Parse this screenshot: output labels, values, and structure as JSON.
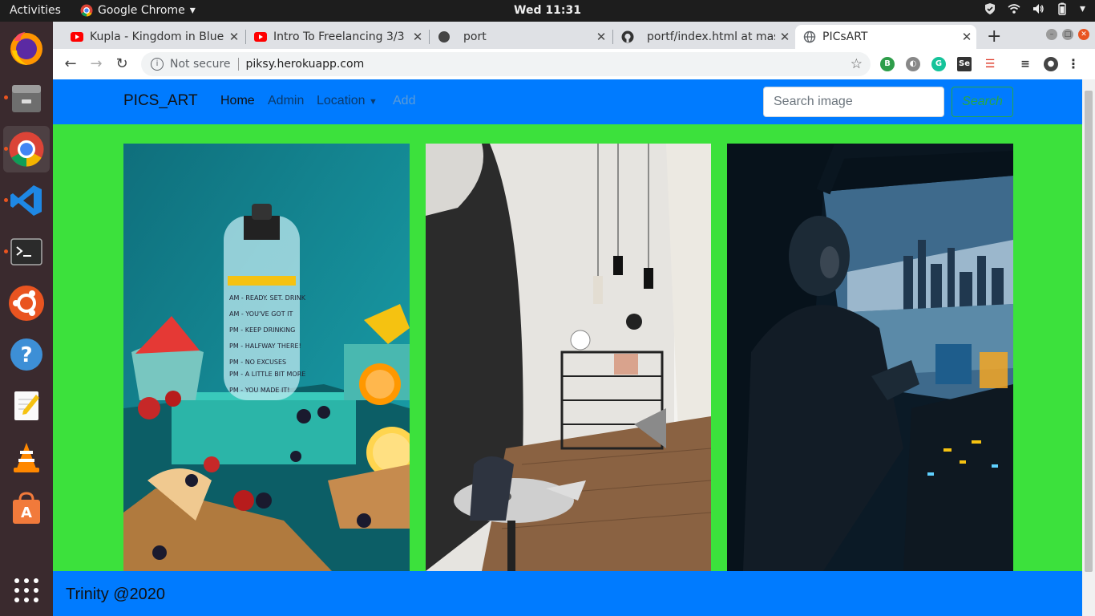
{
  "topbar": {
    "activities": "Activities",
    "app_name": "Google Chrome",
    "clock": "Wed 11:31"
  },
  "dock": {
    "icons": [
      "firefox-icon",
      "files-icon",
      "chrome-icon",
      "vscode-icon",
      "terminal-icon",
      "ubuntu-software-icon",
      "help-icon",
      "text-editor-icon",
      "vlc-icon",
      "software-store-icon",
      "app-grid-icon"
    ]
  },
  "browser": {
    "tabs": [
      {
        "title": "Kupla - Kingdom in Blue",
        "icon": "youtube-icon"
      },
      {
        "title": "Intro To Freelancing 3/3",
        "icon": "youtube-icon"
      },
      {
        "title": "port",
        "icon": "globe-icon"
      },
      {
        "title": "portf/index.html at mas",
        "icon": "github-icon"
      },
      {
        "title": "PICsART",
        "icon": "globe-icon"
      }
    ],
    "security_label": "Not secure",
    "url": "piksy.herokuapp.com"
  },
  "site": {
    "brand": "PICS_ART",
    "nav": {
      "home": "Home",
      "admin": "Admin",
      "location": "Location",
      "add": "Add"
    },
    "search": {
      "placeholder": "Search image",
      "button": "Search"
    },
    "images": [
      {
        "alt": "water bottle with fruits"
      },
      {
        "alt": "interior room"
      },
      {
        "alt": "helicopter pilot"
      }
    ],
    "footer": "Trinity @2020"
  },
  "colors": {
    "navbar": "#007bff",
    "page_bg": "#3ce13c",
    "search_button": "#28a745"
  }
}
